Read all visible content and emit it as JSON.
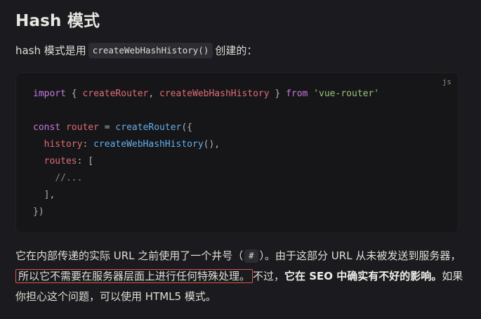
{
  "heading": "Hash 模式",
  "intro": {
    "before": "hash 模式是用",
    "code": "createWebHashHistory()",
    "after": "创建的："
  },
  "code_block": {
    "lang": "js",
    "lines": [
      [
        {
          "t": "import",
          "c": "kw"
        },
        {
          "t": " { ",
          "c": "pn"
        },
        {
          "t": "createRouter",
          "c": "id"
        },
        {
          "t": ", ",
          "c": "pn"
        },
        {
          "t": "createWebHashHistory",
          "c": "id"
        },
        {
          "t": " } ",
          "c": "pn"
        },
        {
          "t": "from",
          "c": "kw"
        },
        {
          "t": " ",
          "c": "pn"
        },
        {
          "t": "'vue-router'",
          "c": "str"
        }
      ],
      [],
      [
        {
          "t": "const",
          "c": "kw"
        },
        {
          "t": " ",
          "c": "pn"
        },
        {
          "t": "router",
          "c": "id"
        },
        {
          "t": " = ",
          "c": "pn"
        },
        {
          "t": "createRouter",
          "c": "fn"
        },
        {
          "t": "({",
          "c": "pn"
        }
      ],
      [
        {
          "t": "  ",
          "c": "pn"
        },
        {
          "t": "history",
          "c": "id"
        },
        {
          "t": ": ",
          "c": "pn"
        },
        {
          "t": "createWebHashHistory",
          "c": "fn"
        },
        {
          "t": "(),",
          "c": "pn"
        }
      ],
      [
        {
          "t": "  ",
          "c": "pn"
        },
        {
          "t": "routes",
          "c": "id"
        },
        {
          "t": ": [",
          "c": "pn"
        }
      ],
      [
        {
          "t": "    ",
          "c": "pn"
        },
        {
          "t": "//...",
          "c": "cm"
        }
      ],
      [
        {
          "t": "  ],",
          "c": "pn"
        }
      ],
      [
        {
          "t": "})",
          "c": "pn"
        }
      ]
    ]
  },
  "paragraph": {
    "p1": "它在内部传递的实际 URL 之前使用了一个井号（",
    "hash": "#",
    "p2": "）。由于这部分 URL 从未被发送到服务器，",
    "highlighted": "所以它不需要在服务器层面上进行任何特殊处理。",
    "p3": "不过，",
    "bold": "它在 SEO 中确实有不好的影响。",
    "p4": "如果你担心这个问题，可以使用 HTML5 模式。"
  }
}
